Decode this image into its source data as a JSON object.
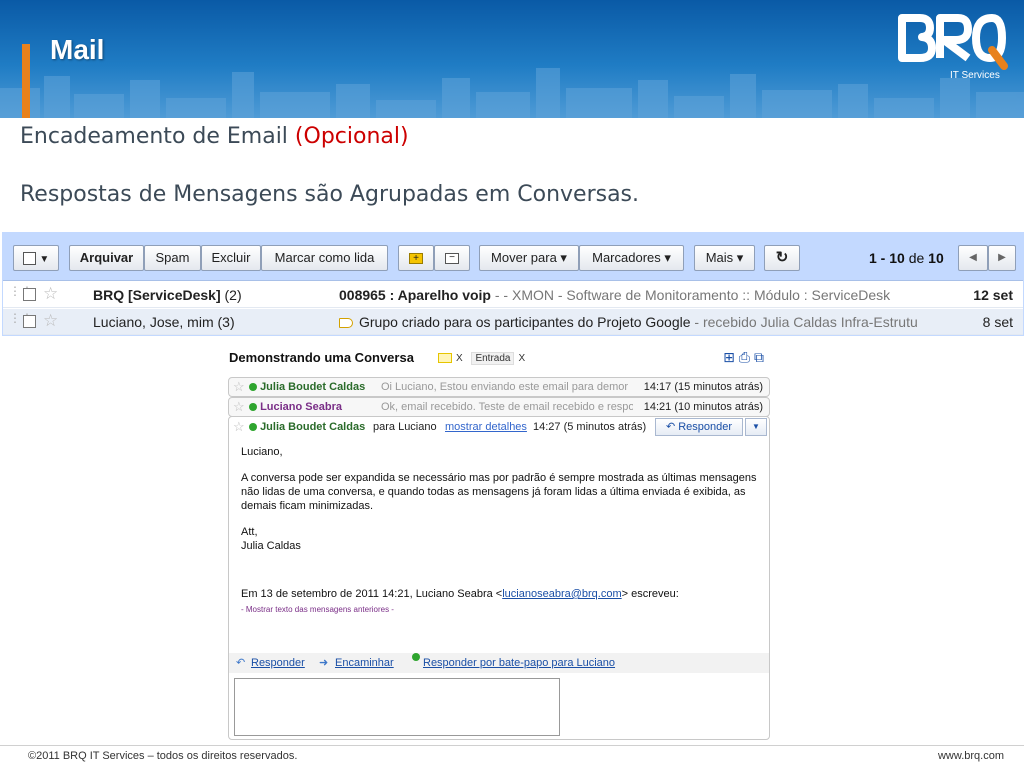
{
  "banner": {
    "title": "Mail",
    "logo_text": "IT Services"
  },
  "headings": {
    "h1": "Encadeamento de Email ",
    "h1_optional": "(Opcional)",
    "h2": "Respostas de Mensagens são Agrupadas em Conversas."
  },
  "toolbar": {
    "archive": "Arquivar",
    "spam": "Spam",
    "delete": "Excluir",
    "mark_read": "Marcar como lida",
    "move_to": "Mover para ▾",
    "labels": "Marcadores ▾",
    "more": "Mais ▾",
    "pager_range": "1 - 10",
    "pager_of": " de ",
    "pager_total": "10"
  },
  "inbox": [
    {
      "sender": "BRQ [ServiceDesk]",
      "count": " (2)",
      "subject": "008965 : Aparelho voip",
      "snippet": " - - XMON - Software de Monitoramento :: Módulo : ServiceDesk",
      "date": "12 set"
    },
    {
      "sender": "Luciano, Jose, mim (3)",
      "subject": "Grupo criado para os participantes do Projeto Google",
      "snippet": " - recebido Julia Caldas Infra-Estrutu",
      "date": "8 set"
    }
  ],
  "conversation": {
    "title": "Demonstrando uma Conversa",
    "label_inbox": "Entrada",
    "close_x": "X",
    "messages": [
      {
        "from": "Julia Boudet Caldas",
        "preview": "Oi Luciano, Estou enviando este email para demor",
        "time": "14:17 (15 minutos atrás)"
      },
      {
        "from": "Luciano Seabra",
        "preview": "Ok, email recebido. Teste de email recebido e respond",
        "time": "14:21 (10 minutos atrás)"
      }
    ],
    "open": {
      "from": "Julia Boudet Caldas",
      "to": "para Luciano",
      "details": "mostrar detalhes",
      "time": "14:27 (5 minutos atrás)",
      "reply": "Responder",
      "greeting": "Luciano,",
      "body": "A conversa pode ser expandida se necessário mas por padrão é sempre mostrada as últimas mensagens não lidas de uma conversa, e quando todas as mensagens já foram lidas a última enviada é exibida, as demais ficam minimizadas.",
      "signoff": "Att,",
      "signature": "Julia Caldas",
      "quote_prefix": "Em 13 de setembro de 2011 14:21, Luciano Seabra <",
      "quote_email": "lucianoseabra@brq.com",
      "quote_suffix": "> escreveu:",
      "show_previous": "- Mostrar texto das mensagens anteriores -"
    },
    "actions": {
      "reply": "Responder",
      "forward": "Encaminhar",
      "chat_reply": "Responder por bate-papo para Luciano"
    }
  },
  "footer": {
    "left": "©2011 BRQ IT Services – todos os direitos reservados.",
    "right": "www.brq.com"
  },
  "colors": {
    "banner": "#1f7cc4",
    "accent": "#e8811c",
    "optional": "#cc0000",
    "gmail_toolbar": "#c3d9ff"
  }
}
